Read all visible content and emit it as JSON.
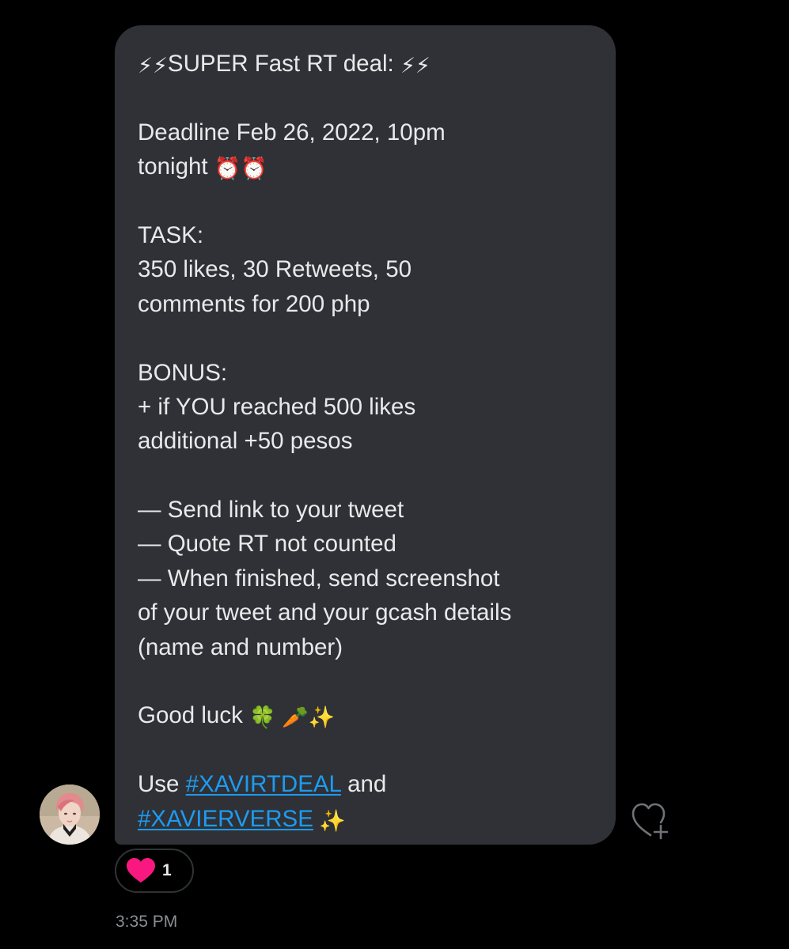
{
  "message": {
    "title_emoji_left": "⚡⚡",
    "title_text": "SUPER Fast RT deal: ",
    "title_emoji_right": "⚡⚡",
    "deadline_line1": "Deadline Feb 26, 2022, 10pm",
    "deadline_line2_text": "tonight ",
    "deadline_emoji": "⏰⏰",
    "task_heading": "TASK:",
    "task_line1": "350 likes, 30 Retweets, 50",
    "task_line2": "comments for 200 php",
    "bonus_heading": "BONUS:",
    "bonus_line1": "+ if YOU reached 500 likes",
    "bonus_line2": "additional +50 pesos",
    "rule1": "— Send link to your tweet",
    "rule2": "— Quote RT not counted",
    "rule3_line1": "— When finished, send screenshot",
    "rule3_line2": "of your tweet and your gcash details",
    "rule3_line3": "(name and number)",
    "goodluck_text": "Good luck ",
    "goodluck_emoji": "🍀 🥕✨",
    "use_text": "Use ",
    "hashtag1": "#XAVIRTDEAL",
    "and_text": " and",
    "hashtag2": "#XAVIERVERSE",
    "sparkle_emoji": " ✨"
  },
  "reaction": {
    "icon": "heart-icon",
    "count": "1"
  },
  "timestamp": "3:35 PM",
  "colors": {
    "bubble": "#2f3136",
    "text": "#e7e9ea",
    "link": "#1d9bf0",
    "heart": "#f91880",
    "muted": "#8b8f94"
  }
}
